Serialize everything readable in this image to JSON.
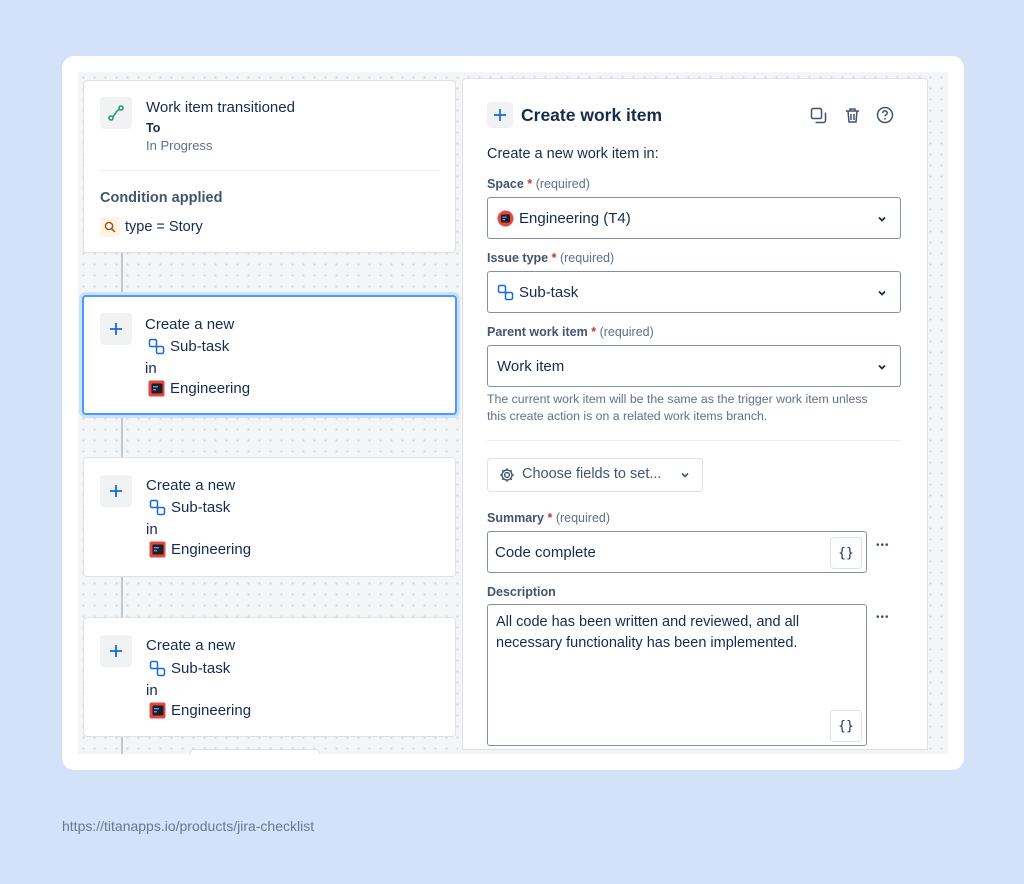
{
  "footer": {
    "url": "https://titanapps.io/products/jira-checklist"
  },
  "trigger_card": {
    "title": "Work item transitioned",
    "to_label": "To",
    "status": "In Progress",
    "condition_heading": "Condition applied",
    "condition_text": "type = Story"
  },
  "action_cards": [
    {
      "line1": "Create a new",
      "issue_type": "Sub-task",
      "in": "in",
      "space": "Engineering",
      "selected": true
    },
    {
      "line1": "Create a new",
      "issue_type": "Sub-task",
      "in": "in",
      "space": "Engineering",
      "selected": false
    },
    {
      "line1": "Create a new",
      "issue_type": "Sub-task",
      "in": "in",
      "space": "Engineering",
      "selected": false
    }
  ],
  "panel": {
    "title": "Create work item",
    "subtitle": "Create a new work item in:",
    "space": {
      "label": "Space",
      "required": "*",
      "note": "(required)",
      "value": "Engineering (T4)"
    },
    "issue_type": {
      "label": "Issue type",
      "required": "*",
      "note": "(required)",
      "value": "Sub-task"
    },
    "parent": {
      "label": "Parent work item",
      "required": "*",
      "note": "(required)",
      "value": "Work item",
      "help_line1": "The current work item will be the same as the trigger work item unless",
      "help_line2": "this create action is on a related work items branch."
    },
    "choose_fields": "Choose fields to set...",
    "summary": {
      "label": "Summary",
      "required": "*",
      "note": "(required)",
      "value": "Code complete",
      "smart_value_btn": "{}"
    },
    "description": {
      "label": "Description",
      "line1": "All code has been written and reviewed, and all",
      "line2": "necessary functionality has been implemented.",
      "smart_value_btn": "{}"
    },
    "more_actions": "•••"
  },
  "colors": {
    "accent": "#1868db",
    "required": "#c9372c",
    "selected_border": "#4c9aff",
    "background": "#d3e2f8"
  },
  "icons": [
    "transition-icon",
    "search-icon",
    "plus-icon",
    "subtask-icon",
    "engineering-space-icon",
    "duplicate-icon",
    "trash-icon",
    "help-icon",
    "gear-icon",
    "chevron-down-icon"
  ]
}
